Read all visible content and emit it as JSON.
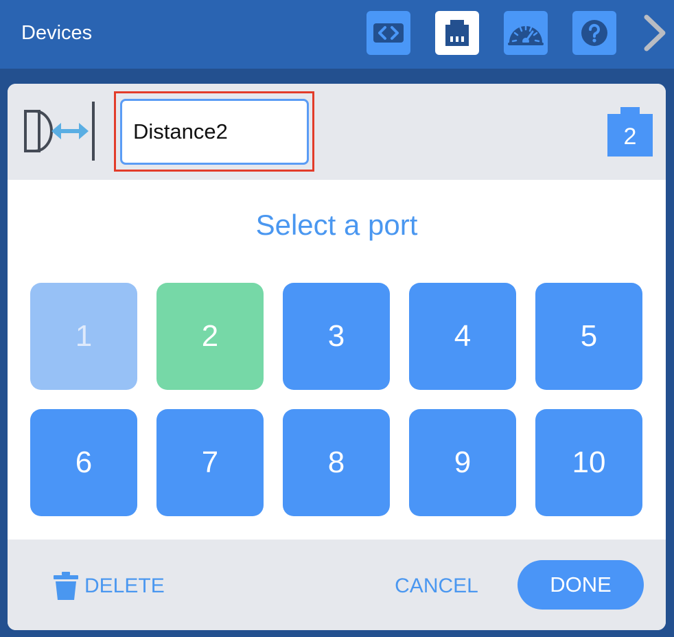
{
  "topbar": {
    "title": "Devices",
    "tools": [
      {
        "icon": "code-brackets-icon",
        "active": false
      },
      {
        "icon": "ethernet-port-icon",
        "active": true
      },
      {
        "icon": "dashboard-gauge-icon",
        "active": false
      },
      {
        "icon": "help-icon",
        "active": false
      }
    ],
    "next_icon": "chevron-right-icon"
  },
  "dialog": {
    "sensor_icon": "distance-sensor-icon",
    "device_name": "Distance2",
    "port_badge": "2",
    "select_title": "Select a port",
    "ports": [
      {
        "label": "1",
        "state": "disabled"
      },
      {
        "label": "2",
        "state": "selected"
      },
      {
        "label": "3",
        "state": "available"
      },
      {
        "label": "4",
        "state": "available"
      },
      {
        "label": "5",
        "state": "available"
      },
      {
        "label": "6",
        "state": "available"
      },
      {
        "label": "7",
        "state": "available"
      },
      {
        "label": "8",
        "state": "available"
      },
      {
        "label": "9",
        "state": "available"
      },
      {
        "label": "10",
        "state": "available"
      }
    ],
    "footer": {
      "delete_label": "DELETE",
      "cancel_label": "CANCEL",
      "done_label": "DONE"
    }
  },
  "colors": {
    "background": "#23508f",
    "topbar": "#2a64b2",
    "accent_blue": "#4a95f7",
    "selected_green": "#76d8a7",
    "disabled_blue": "#97c1f6",
    "highlight_red": "#e23c2a"
  }
}
